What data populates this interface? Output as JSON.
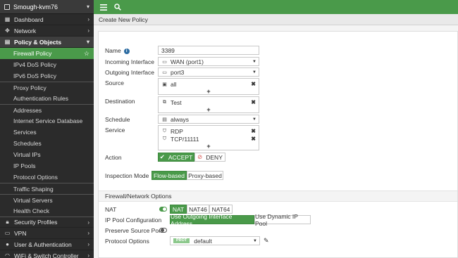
{
  "sidebar": {
    "device_name": "Smough-kvm76",
    "sections": {
      "dashboard": "Dashboard",
      "network": "Network",
      "policy_objects": "Policy & Objects",
      "security_profiles": "Security Profiles",
      "vpn": "VPN",
      "user_auth": "User & Authentication",
      "wifi_switch": "WiFi & Switch Controller"
    },
    "items": {
      "firewall_policy": "Firewall Policy",
      "ipv4_dos": "IPv4 DoS Policy",
      "ipv6_dos": "IPv6 DoS Policy",
      "proxy_policy": "Proxy Policy",
      "auth_rules": "Authentication Rules",
      "addresses": "Addresses",
      "isdb": "Internet Service Database",
      "services": "Services",
      "schedules": "Schedules",
      "virtual_ips": "Virtual IPs",
      "ip_pools": "IP Pools",
      "protocol_options": "Protocol Options",
      "traffic_shaping": "Traffic Shaping",
      "virtual_servers": "Virtual Servers",
      "health_check": "Health Check"
    }
  },
  "header": {
    "title": "Create New Policy"
  },
  "form": {
    "name_label": "Name",
    "name_value": "3389",
    "incoming_label": "Incoming Interface",
    "incoming_value": "WAN (port1)",
    "outgoing_label": "Outgoing Interface",
    "outgoing_value": "port3",
    "source_label": "Source",
    "source_value": "all",
    "destination_label": "Destination",
    "destination_value": "Test",
    "schedule_label": "Schedule",
    "schedule_value": "always",
    "service_label": "Service",
    "service_values": [
      "RDP",
      "TCP/11111"
    ],
    "plus": "+",
    "action_label": "Action",
    "accept_label": "ACCEPT",
    "deny_label": "DENY",
    "inspection_label": "Inspection Mode",
    "flow_based": "Flow-based",
    "proxy_based": "Proxy-based"
  },
  "fw_options": {
    "section_title": "Firewall/Network Options",
    "nat_label": "NAT",
    "nat_buttons": [
      "NAT",
      "NAT46",
      "NAT64"
    ],
    "ip_pool_label": "IP Pool Configuration",
    "use_outgoing": "Use Outgoing Interface Address",
    "use_dynamic": "Use Dynamic IP Pool",
    "preserve_label": "Preserve Source Port",
    "protocol_label": "Protocol Options",
    "protocol_badge": "PROT",
    "protocol_value": "default"
  },
  "colors": {
    "accent": "#4a9a4a",
    "sidebar_bg": "#2b2b2b",
    "deny_red": "#d9534f"
  }
}
